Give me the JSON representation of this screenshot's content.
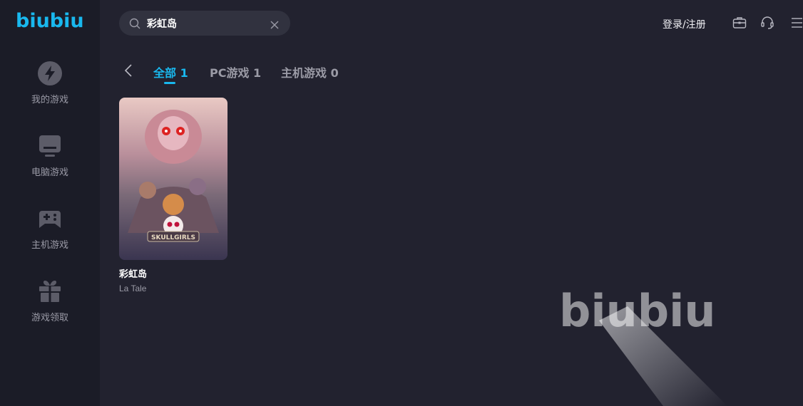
{
  "app": {
    "logo": "biubiu"
  },
  "sidebar": {
    "items": [
      {
        "label": "我的游戏",
        "icon": "lightning-icon"
      },
      {
        "label": "电脑游戏",
        "icon": "monitor-icon"
      },
      {
        "label": "主机游戏",
        "icon": "gamepad-icon"
      },
      {
        "label": "游戏领取",
        "icon": "gift-icon"
      }
    ]
  },
  "header": {
    "search": {
      "value": "彩虹岛",
      "placeholder": ""
    },
    "login_label": "登录/注册",
    "icons": [
      "toolbox-icon",
      "headset-icon",
      "menu-icon"
    ]
  },
  "tabs": [
    {
      "label": "全部 1",
      "active": true
    },
    {
      "label": "PC游戏 1",
      "active": false
    },
    {
      "label": "主机游戏 0",
      "active": false
    }
  ],
  "results": [
    {
      "title": "彩虹岛",
      "subtitle": "La Tale",
      "cover_logo": "SKULLGIRLS"
    }
  ],
  "watermark": "biubiu",
  "colors": {
    "accent": "#19b8ee",
    "sidebar_bg": "#1b1c27",
    "main_bg": "#22222f"
  }
}
